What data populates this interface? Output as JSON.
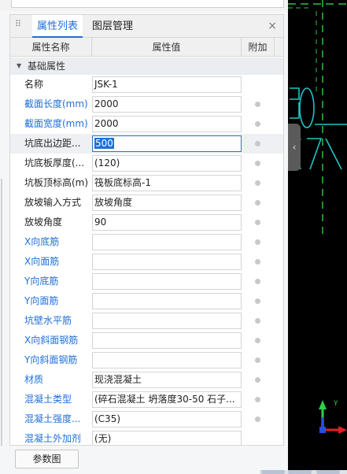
{
  "panel": {
    "tabs": [
      {
        "label": "属性列表",
        "active": true
      },
      {
        "label": "图层管理",
        "active": false
      }
    ],
    "close_glyph": "×",
    "grip_glyph": "⠿",
    "columns": [
      "属性名称",
      "属性值",
      "附加"
    ],
    "group": {
      "label": "基础属性",
      "expanded": true
    },
    "rows": [
      {
        "name": "名称",
        "value": "JSK-1",
        "name_color": "dark",
        "has_dot": false
      },
      {
        "name": "截面长度(mm)",
        "value": "2000",
        "name_color": "blue",
        "has_dot": true
      },
      {
        "name": "截面宽度(mm)",
        "value": "2000",
        "name_color": "blue",
        "has_dot": true
      },
      {
        "name": "坑底出边距...",
        "value": "500",
        "name_color": "dark",
        "has_dot": true,
        "editing": true
      },
      {
        "name": "坑底板厚度(...",
        "value": "(120)",
        "name_color": "dark",
        "has_dot": true
      },
      {
        "name": "坑板顶标高(m)",
        "value": "筏板底标高-1",
        "name_color": "dark",
        "has_dot": true
      },
      {
        "name": "放坡输入方式",
        "value": "放坡角度",
        "name_color": "dark",
        "has_dot": true
      },
      {
        "name": "放坡角度",
        "value": "90",
        "name_color": "dark",
        "has_dot": true
      },
      {
        "name": "X向底筋",
        "value": "",
        "name_color": "blue",
        "has_dot": true
      },
      {
        "name": "X向面筋",
        "value": "",
        "name_color": "blue",
        "has_dot": true
      },
      {
        "name": "Y向底筋",
        "value": "",
        "name_color": "blue",
        "has_dot": true
      },
      {
        "name": "Y向面筋",
        "value": "",
        "name_color": "blue",
        "has_dot": true
      },
      {
        "name": "坑壁水平筋",
        "value": "",
        "name_color": "blue",
        "has_dot": true
      },
      {
        "name": "X向斜面钢筋",
        "value": "",
        "name_color": "blue",
        "has_dot": true
      },
      {
        "name": "Y向斜面钢筋",
        "value": "",
        "name_color": "blue",
        "has_dot": true
      },
      {
        "name": "材质",
        "value": "现浇混凝土",
        "name_color": "blue",
        "has_dot": true
      },
      {
        "name": "混凝土类型",
        "value": "(碎石混凝土 坍落度30-50 石子...",
        "name_color": "blue",
        "has_dot": true
      },
      {
        "name": "混凝土强度...",
        "value": "(C35)",
        "name_color": "blue",
        "has_dot": true
      },
      {
        "name": "混凝土外加剂",
        "value": "(无)",
        "name_color": "blue",
        "has_dot": false
      }
    ],
    "footer_button": "参数图"
  },
  "viewport": {
    "background": "#000000",
    "line_color": "#21c4c4",
    "dash_color": "#2fbf3f",
    "axis_y_color": "#2fd04a",
    "axis_x_color": "#e02020",
    "axis_z_color": "#2a4fe0",
    "axis_y_label": "Y",
    "collapse_glyph": "‹"
  }
}
